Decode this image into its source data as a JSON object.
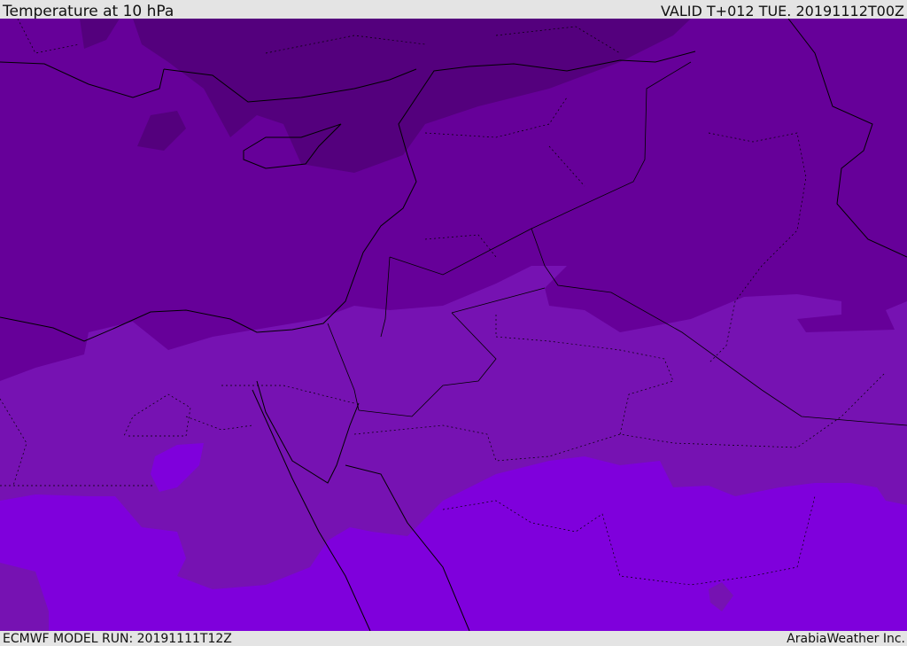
{
  "header": {
    "title": "Temperature at 10 hPa",
    "valid": "VALID T+012 TUE. 20191112T00Z"
  },
  "footer": {
    "model_run": "ECMWF MODEL RUN: 20191111T12Z",
    "credit": "ArabiaWeather Inc."
  },
  "map": {
    "variable": "temperature",
    "level": "10 hPa",
    "colors": {
      "dark": "#54007d",
      "mid": "#660099",
      "light": "#7612b2",
      "bright": "#7f00dc",
      "borders": "#000000"
    }
  }
}
